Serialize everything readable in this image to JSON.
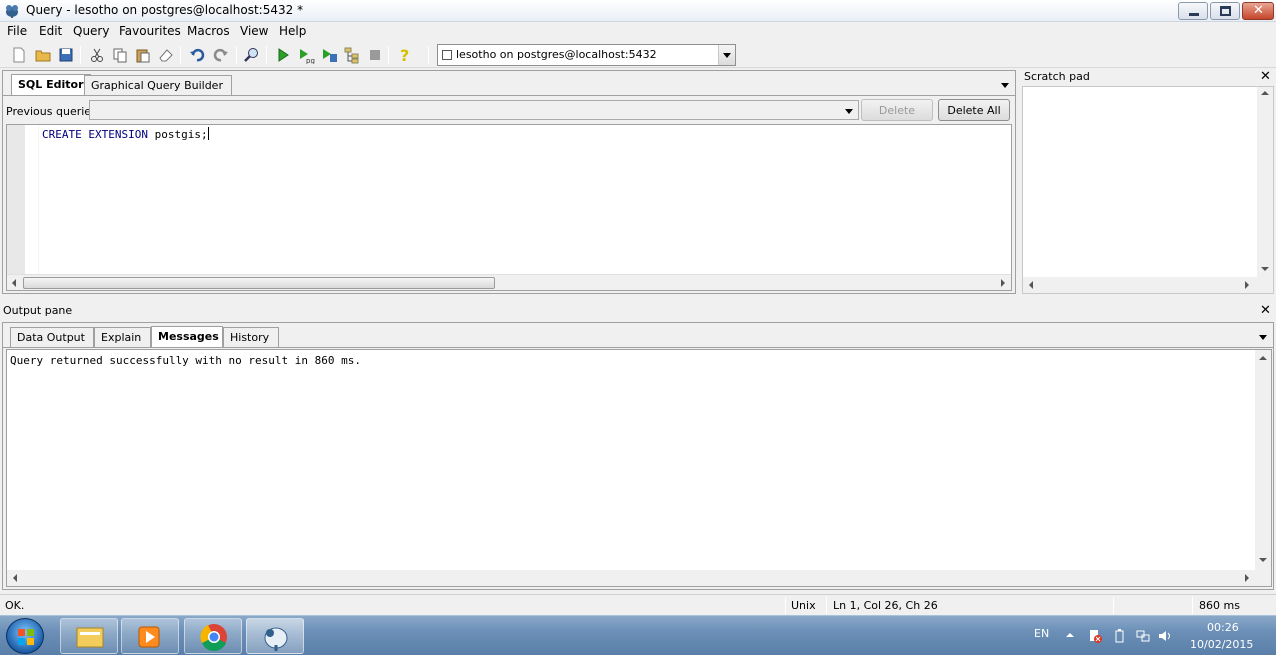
{
  "window": {
    "title": "Query - lesotho on postgres@localhost:5432 *"
  },
  "menu": [
    "File",
    "Edit",
    "Query",
    "Favourites",
    "Macros",
    "View",
    "Help"
  ],
  "toolbar": {
    "icons": [
      "new-file-icon",
      "open-folder-icon",
      "save-icon",
      "cut-icon",
      "copy-icon",
      "paste-icon",
      "clear-icon",
      "undo-icon",
      "redo-icon",
      "find-icon",
      "execute-icon",
      "execute-pgscript-icon",
      "execute-to-file-icon",
      "explain-icon",
      "cancel-query-icon",
      "help-icon"
    ],
    "connection": "lesotho on postgres@localhost:5432"
  },
  "editor": {
    "tabs": [
      "SQL Editor",
      "Graphical Query Builder"
    ],
    "active_tab": "SQL Editor",
    "previous_queries_label": "Previous queries",
    "previous_queries_value": "",
    "delete_label": "Delete",
    "delete_all_label": "Delete All",
    "sql_keyword_1": "CREATE",
    "sql_keyword_2": "EXTENSION",
    "sql_rest": " postgis;"
  },
  "scratch_pad": {
    "title": "Scratch pad"
  },
  "output": {
    "title": "Output pane",
    "tabs": [
      "Data Output",
      "Explain",
      "Messages",
      "History"
    ],
    "active_tab": "Messages",
    "message": "Query returned successfully with no result in 860 ms."
  },
  "status": {
    "state": "OK.",
    "line_endings": "Unix",
    "position": "Ln 1, Col 26, Ch 26",
    "duration": "860 ms"
  },
  "taskbar": {
    "apps": [
      "windows-explorer",
      "media-player",
      "chrome",
      "pgadmin"
    ],
    "language": "EN",
    "time": "00:26",
    "date": "10/02/2015"
  },
  "colors": {
    "sql_keyword": "#00007f",
    "close_button": "#c5462a",
    "taskbar": "#6b8fb7"
  }
}
